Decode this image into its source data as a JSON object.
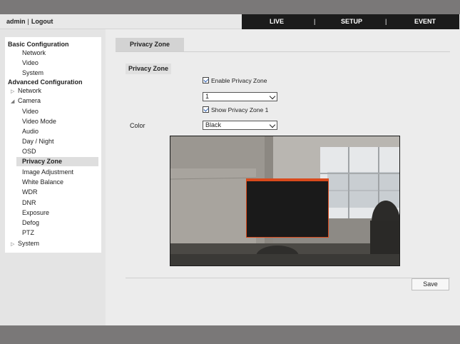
{
  "header": {
    "user": "admin",
    "separator": "|",
    "logout": "Logout",
    "nav": [
      "LIVE",
      "SETUP",
      "EVENT"
    ],
    "nav_separator": "|"
  },
  "sidebar": {
    "items": [
      {
        "label": "Basic Configuration"
      },
      {
        "label": "Network"
      },
      {
        "label": "Video"
      },
      {
        "label": "System"
      },
      {
        "label": "Advanced Configuration"
      },
      {
        "label": "Network"
      },
      {
        "label": "Camera"
      },
      {
        "label": "Video"
      },
      {
        "label": "Video Mode"
      },
      {
        "label": "Audio"
      },
      {
        "label": "Day / Night"
      },
      {
        "label": "OSD"
      },
      {
        "label": "Privacy Zone"
      },
      {
        "label": "Image Adjustment"
      },
      {
        "label": "White Balance"
      },
      {
        "label": "WDR"
      },
      {
        "label": "DNR"
      },
      {
        "label": "Exposure"
      },
      {
        "label": "Defog"
      },
      {
        "label": "PTZ"
      },
      {
        "label": "System"
      }
    ]
  },
  "main": {
    "tab_label": "Privacy Zone",
    "section_label": "Privacy Zone",
    "enable_label": "Enable Privacy Zone",
    "enable_checked": true,
    "zone_select": "1",
    "show_label": "Show Privacy Zone 1",
    "show_checked": true,
    "color_label": "Color",
    "color_select": "Black",
    "zone_color": "#1a1a1a",
    "zone_border_color": "#d94a1c",
    "save_label": "Save"
  }
}
